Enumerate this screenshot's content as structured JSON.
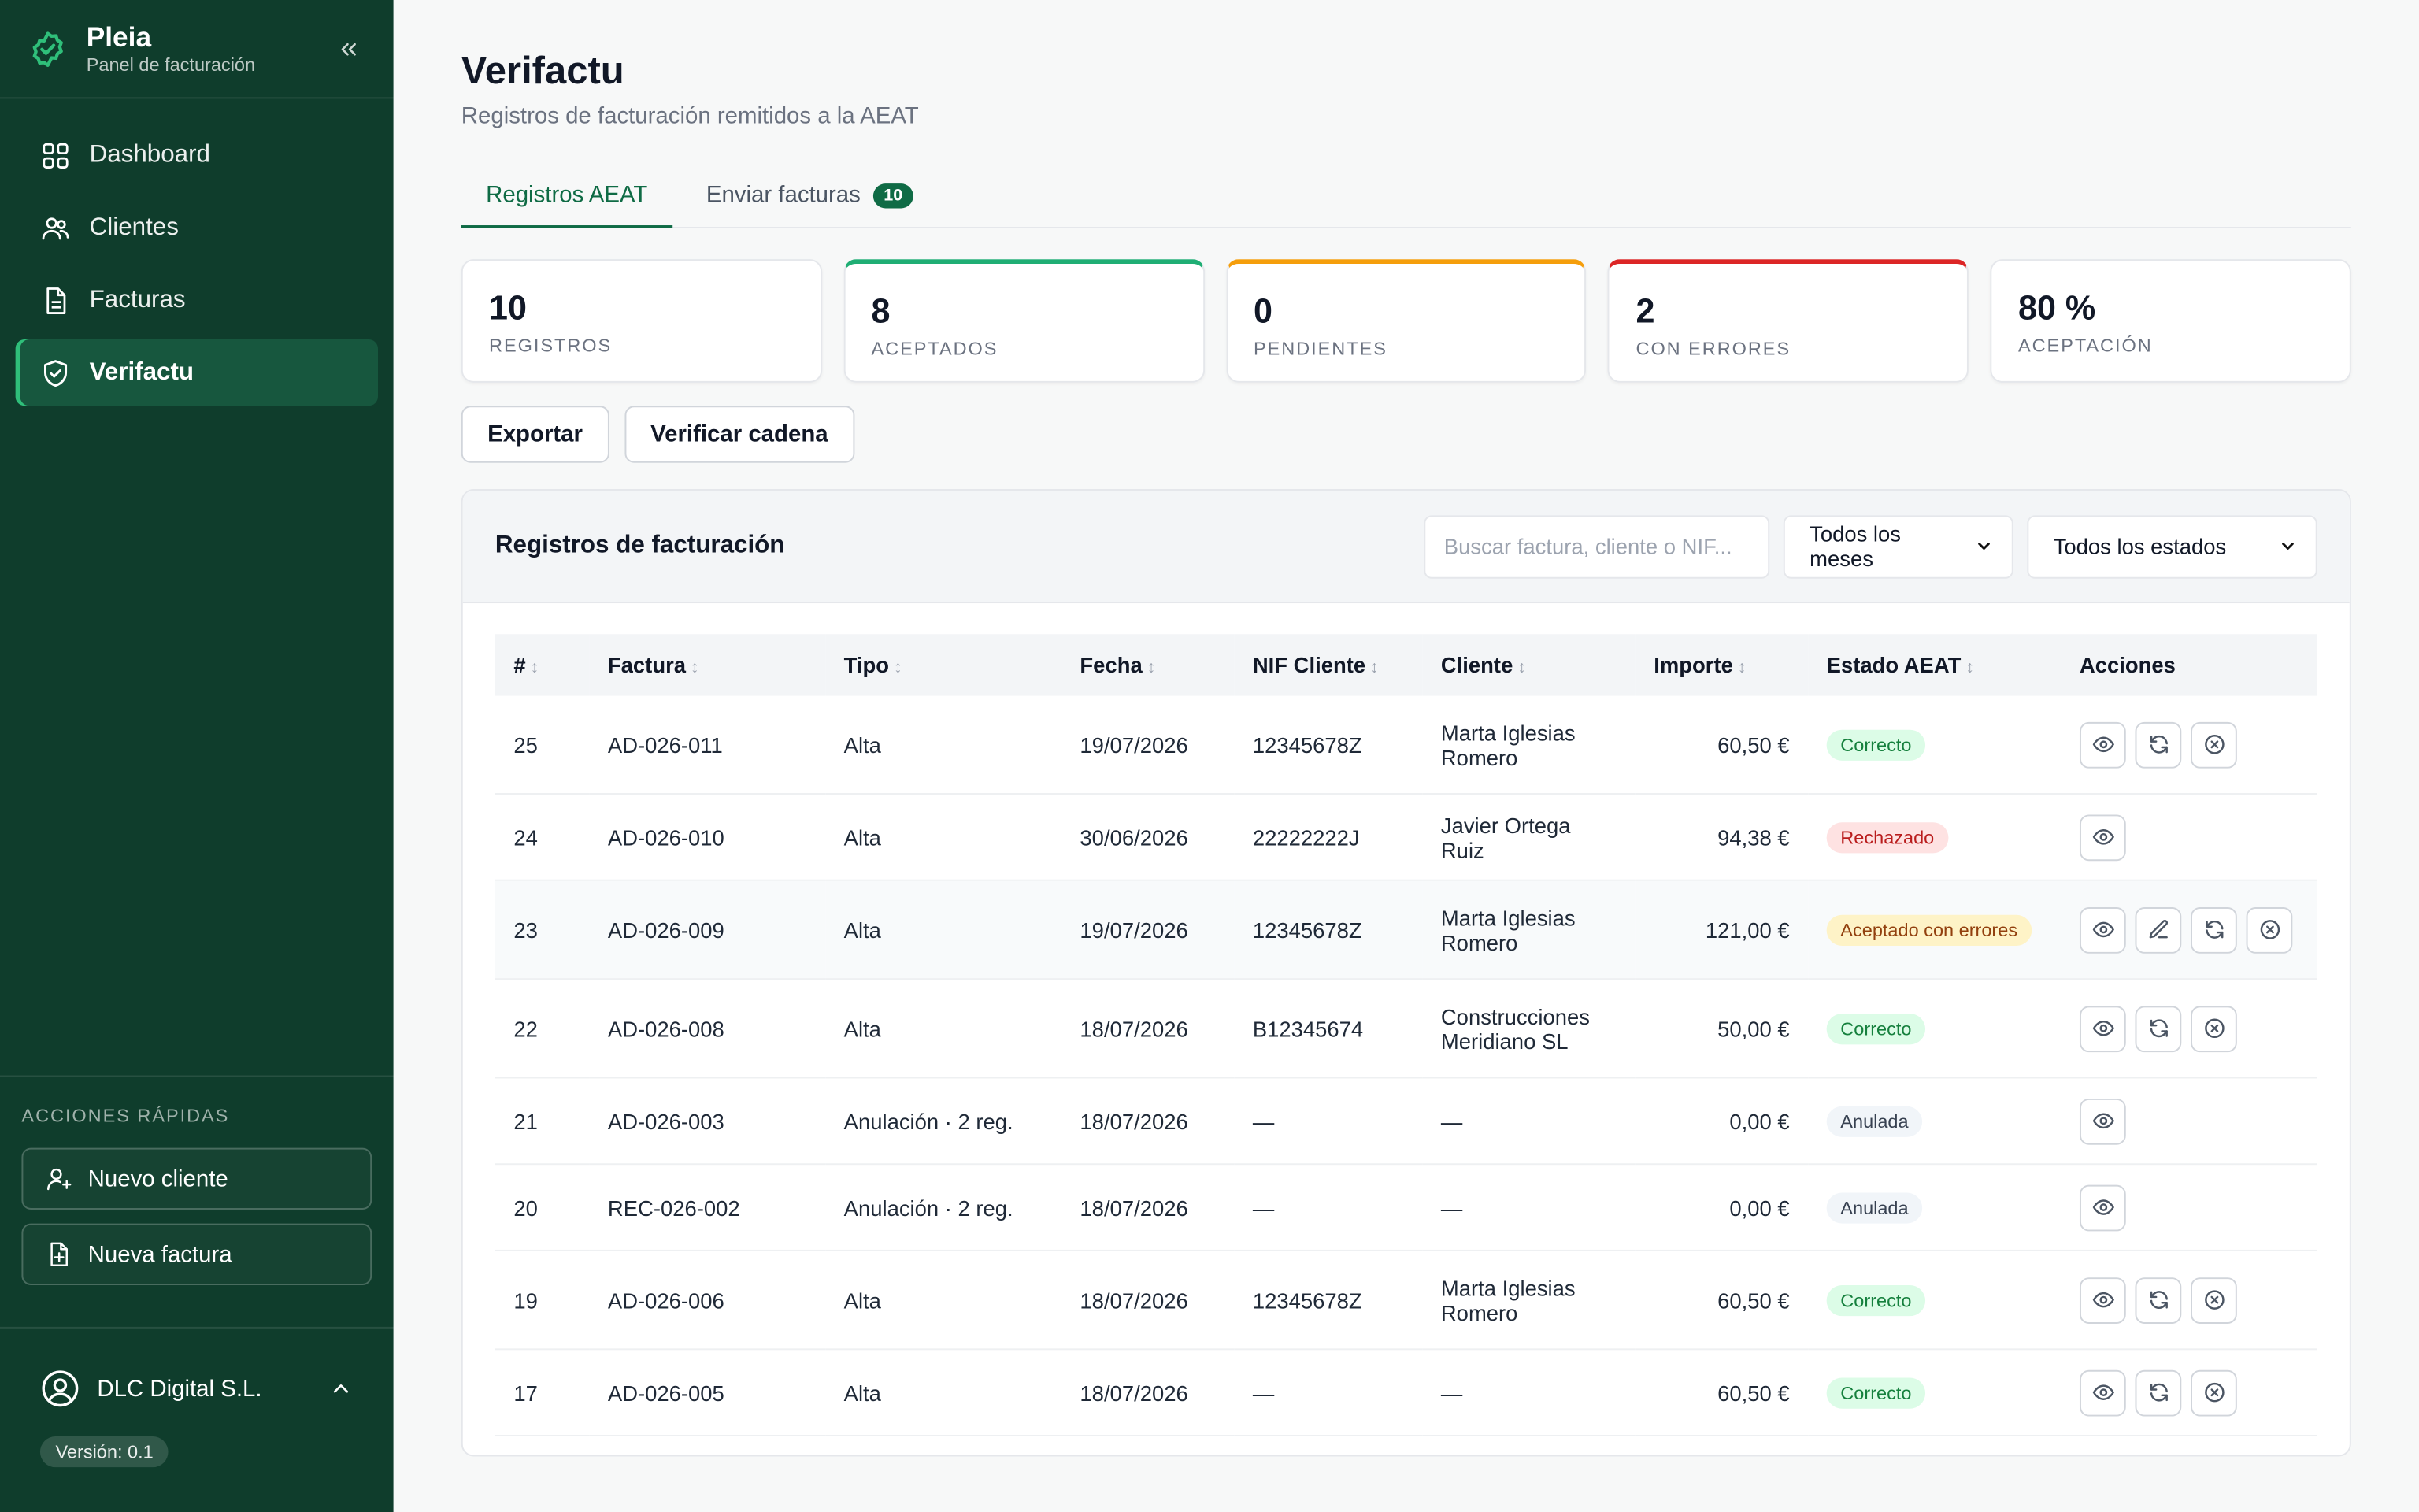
{
  "brand": {
    "name": "Pleia",
    "subtitle": "Panel de facturación"
  },
  "nav": [
    {
      "label": "Dashboard",
      "icon": "grid-icon"
    },
    {
      "label": "Clientes",
      "icon": "users-icon"
    },
    {
      "label": "Facturas",
      "icon": "file-icon"
    },
    {
      "label": "Verifactu",
      "icon": "shield-check-icon",
      "active": true
    }
  ],
  "quick": {
    "title": "ACCIONES RÁPIDAS",
    "new_client": "Nuevo cliente",
    "new_invoice": "Nueva factura"
  },
  "account": {
    "name": "DLC Digital S.L.",
    "version": "Versión: 0.1"
  },
  "page": {
    "title": "Verifactu",
    "subtitle": "Registros de facturación remitidos a la AEAT"
  },
  "tabs": [
    {
      "label": "Registros AEAT",
      "active": true
    },
    {
      "label": "Enviar facturas",
      "badge": "10"
    }
  ],
  "stats": [
    {
      "value": "10",
      "label": "REGISTROS"
    },
    {
      "value": "8",
      "label": "ACEPTADOS"
    },
    {
      "value": "0",
      "label": "PENDIENTES"
    },
    {
      "value": "2",
      "label": "CON ERRORES"
    },
    {
      "value": "80 %",
      "label": "ACEPTACIÓN"
    }
  ],
  "toolbar": {
    "export": "Exportar",
    "verify": "Verificar cadena"
  },
  "panel": {
    "title": "Registros de facturación",
    "search_placeholder": "Buscar factura, cliente o NIF...",
    "month_filter": "Todos los meses",
    "status_filter": "Todos los estados"
  },
  "table": {
    "columns": [
      "#",
      "Factura",
      "Tipo",
      "Fecha",
      "NIF Cliente",
      "Cliente",
      "Importe",
      "Estado AEAT",
      "Acciones"
    ],
    "rows": [
      {
        "num": "25",
        "invoice": "AD-026-011",
        "type": "Alta",
        "date": "19/07/2026",
        "nif": "12345678Z",
        "client": "Marta Iglesias Romero",
        "amount": "60,50 €",
        "status": "Correcto"
      },
      {
        "num": "24",
        "invoice": "AD-026-010",
        "type": "Alta",
        "date": "30/06/2026",
        "nif": "22222222J",
        "client": "Javier Ortega Ruiz",
        "amount": "94,38 €",
        "status": "Rechazado"
      },
      {
        "num": "23",
        "invoice": "AD-026-009",
        "type": "Alta",
        "date": "19/07/2026",
        "nif": "12345678Z",
        "client": "Marta Iglesias Romero",
        "amount": "121,00 €",
        "status": "Aceptado con errores"
      },
      {
        "num": "22",
        "invoice": "AD-026-008",
        "type": "Alta",
        "date": "18/07/2026",
        "nif": "B12345674",
        "client": "Construcciones Meridiano SL",
        "amount": "50,00 €",
        "status": "Correcto"
      },
      {
        "num": "21",
        "invoice": "AD-026-003",
        "type": "Anulación · 2 reg.",
        "date": "18/07/2026",
        "nif": "—",
        "client": "—",
        "amount": "0,00 €",
        "status": "Anulada"
      },
      {
        "num": "20",
        "invoice": "REC-026-002",
        "type": "Anulación · 2 reg.",
        "date": "18/07/2026",
        "nif": "—",
        "client": "—",
        "amount": "0,00 €",
        "status": "Anulada"
      },
      {
        "num": "19",
        "invoice": "AD-026-006",
        "type": "Alta",
        "date": "18/07/2026",
        "nif": "12345678Z",
        "client": "Marta Iglesias Romero",
        "amount": "60,50 €",
        "status": "Correcto"
      },
      {
        "num": "17",
        "invoice": "AD-026-005",
        "type": "Alta",
        "date": "18/07/2026",
        "nif": "—",
        "client": "—",
        "amount": "60,50 €",
        "status": "Correcto"
      }
    ]
  },
  "colors": {
    "sidebar": "#0f3d2c",
    "accent": "#0f6b45",
    "ok": "#15803d",
    "error": "#b91c1c",
    "warning": "#92400e"
  }
}
